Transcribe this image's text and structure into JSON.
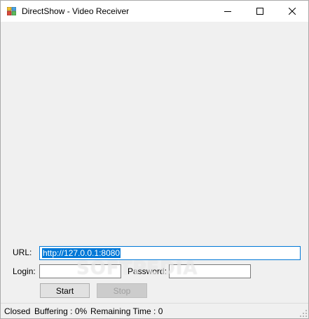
{
  "window": {
    "title": "DirectShow - Video Receiver"
  },
  "icons": {
    "app": "app-icon",
    "minimize": "minimize-icon",
    "maximize": "maximize-icon",
    "close": "close-icon"
  },
  "form": {
    "url_label": "URL:",
    "url_value": "http://127.0.0.1:8080",
    "login_label": "Login:",
    "login_value": "",
    "password_label": "Password:",
    "password_value": "",
    "start_label": "Start",
    "stop_label": "Stop"
  },
  "status": {
    "state": "Closed",
    "buffering": "Buffering : 0%",
    "remaining": "Remaining Time : 0"
  },
  "watermark": "SOFTPEDIA",
  "colors": {
    "selection": "#0078d7",
    "client_bg": "#f0f0f0",
    "titlebar_bg": "#ffffff"
  }
}
